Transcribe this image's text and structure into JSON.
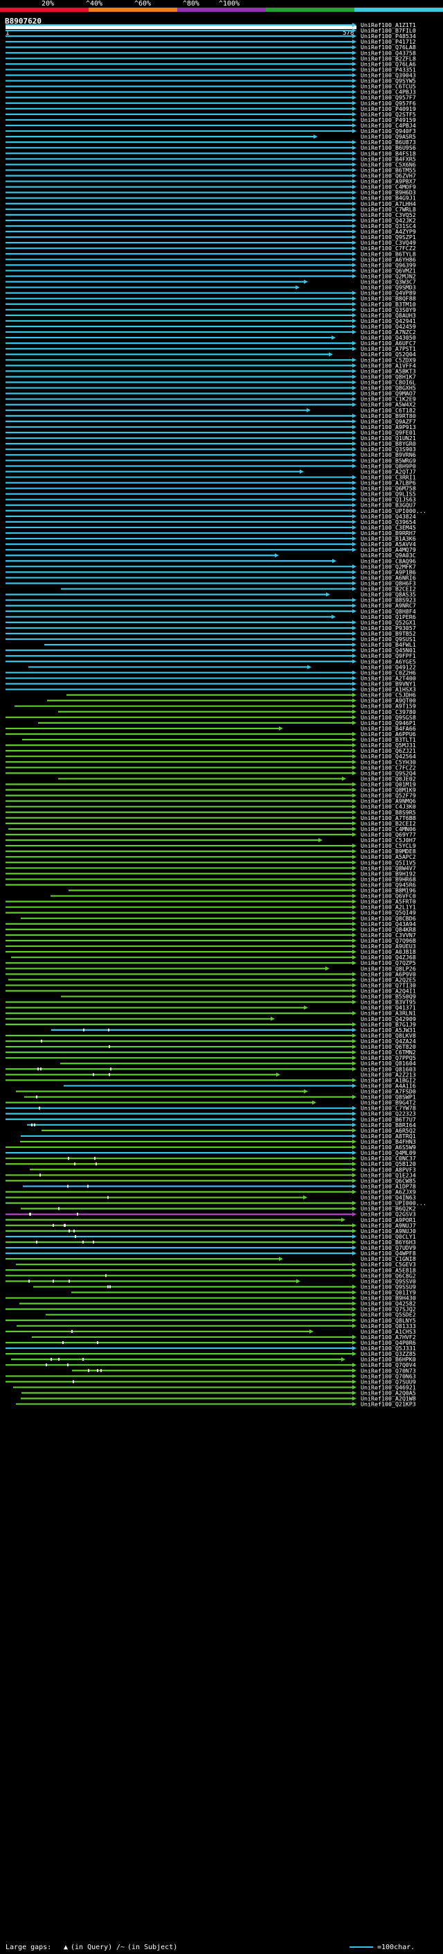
{
  "header": {
    "pct_labels": [
      "20%",
      "^40%",
      "^60%",
      "^80%",
      "^100%"
    ],
    "scale_colors": [
      "#e8112d",
      "#f07f1a",
      "#9c2fb0",
      "#22a32b",
      "#3ec7e8"
    ]
  },
  "query": {
    "id": "B8907620",
    "start": "1",
    "end": "578"
  },
  "colors": {
    "cyan": "#39c4e6",
    "green": "#5fcb2e",
    "magenta": "#b83dc8",
    "tick": "#ffffff"
  },
  "hits": [
    "UniRef100_A1Z1T1",
    "UniRef100_B7FIL0",
    "UniRef100_P48534",
    "UniRef100_P41712",
    "UniRef100_Q76LA8",
    "UniRef100_Q43758",
    "UniRef100_B2ZFL8",
    "UniRef100_Q76LA6",
    "UniRef100_P43351",
    "UniRef100_Q39043",
    "UniRef100_Q9SYW5",
    "UniRef100_C6TCU5",
    "UniRef100_C4PBJ3",
    "UniRef100_Q957F7",
    "UniRef100_Q957F6",
    "UniRef100_P40919",
    "UniRef100_Q2STF5",
    "UniRef100_P49159",
    "UniRef100_C4PBJ4",
    "UniRef100_Q940F3",
    "UniRef100_Q9ASR5",
    "UniRef100_B6U873",
    "UniRef100_B6U9S6",
    "UniRef100_B4FS18",
    "UniRef100_B4FXR5",
    "UniRef100_C5X6N6",
    "UniRef100_B6TM55",
    "UniRef100_Q6ZVH7",
    "UniRef100_A9PBX7",
    "UniRef100_C4MOF9",
    "UniRef100_B9H6D3",
    "UniRef100_B4G9J1",
    "UniRef100_A7LHH4",
    "UniRef100_C7WRL8",
    "UniRef100_C3VQ52",
    "UniRef100_Q42JK2",
    "UniRef100_Q31SC4",
    "UniRef100_A4ZYP9",
    "UniRef100_Q9SZP1",
    "UniRef100_C3VQ49",
    "UniRef100_C7FCZ2",
    "UniRef100_B6TYL8",
    "UniRef100_A6YH86",
    "UniRef100_Q96399",
    "UniRef100_Q6VMZ1",
    "UniRef100_Q2MJN2",
    "UniRef100_Q3W3C7",
    "UniRef100_Q9SMD3",
    "UniRef100_Q4VP89",
    "UniRef100_B8QF88",
    "UniRef100_B3TM10",
    "UniRef100_Q3S0Y9",
    "UniRef100_Q8AUH3",
    "UniRef100_Q42941",
    "UniRef100_Q42459",
    "UniRef100_A7NZC2",
    "UniRef100_Q43050",
    "UniRef100_A6UFC7",
    "UniRef100_A7PST1",
    "UniRef100_Q52Q04",
    "UniRef100_C5ZDX9",
    "UniRef100_A1VFF4",
    "UniRef100_A5BKT3",
    "UniRef100_Q8H1K7",
    "UniRef100_C8OI6L",
    "UniRef100_Q8GXH5",
    "UniRef100_Q9MAO7",
    "UniRef100_C1K2E9",
    "UniRef100_A5W4X2",
    "UniRef100_C6T182",
    "UniRef100_B9RT80",
    "UniRef100_Q9AZF7",
    "UniRef100_A9P913",
    "UniRef100_Q9FE01",
    "UniRef100_Q1UN21",
    "UniRef100_B8YGR0",
    "UniRef100_Q3S903",
    "UniRef100_B9VRN6",
    "UniRef100_B5WRG9",
    "UniRef100_Q8H9P0",
    "UniRef100_A2QTJ7",
    "UniRef100_C3RRI1",
    "UniRef100_A7LBP6",
    "UniRef100_Q6M758",
    "UniRef100_Q9LIS5",
    "UniRef100_Q1JS63",
    "UniRef100_B3GQU7",
    "UniRef100_UPI000...",
    "UniRef100_Q43824",
    "UniRef100_Q39654",
    "UniRef100_C3EM45",
    "UniRef100_B9RRH7",
    "UniRef100_B1A3K6",
    "UniRef100_A5AVV4",
    "UniRef100_A4MQ79",
    "UniRef100_Q9A03C",
    "UniRef100_C8AQ96",
    "UniRef100_Q2MFK7",
    "UniRef100_A9P1B6",
    "UniRef100_A6NRI6",
    "UniRef100_Q8H6F3",
    "UniRef100_B2CEI2",
    "UniRef100_Q8AS35",
    "UniRef100_B8S923",
    "UniRef100_A9NRC7",
    "UniRef100_Q8H8F4",
    "UniRef100_Q1PER6",
    "UniRef100_Q52GX1",
    "UniRef100_P93057",
    "UniRef100_B9TB52",
    "UniRef100_Q9SUS1",
    "UniRef100_B4FWL1",
    "UniRef100_Q45N01",
    "UniRef100_Q9FPF1",
    "UniRef100_A6YGE5",
    "UniRef100_Q49122",
    "UniRef100_C0Z2H6",
    "UniRef100_A2T400",
    "UniRef100_B9VNY1",
    "UniRef100_A1HSX3",
    "UniRef100_C5JDH6",
    "UniRef100_A9QT00",
    "UniRef100_A9T159",
    "UniRef100_C39780",
    "UniRef100_Q9SGS8",
    "UniRef100_Q946P1",
    "UniRef100_B4FA66",
    "UniRef100_A6PPU6",
    "UniRef100_B3TLT1",
    "UniRef100_Q5MJ31",
    "UniRef100_Q6ZJ21",
    "UniRef100_Q42564",
    "UniRef100_C5YH30",
    "UniRef100_C7FCZ2",
    "UniRef100_Q9S2Q4",
    "UniRef100_Q0JE02",
    "UniRef100_Q01M19",
    "UniRef100_Q8M1K9",
    "UniRef100_Q52F79",
    "UniRef100_A9NMQ6",
    "UniRef100_C4J3K0",
    "UniRef100_B8S9R5",
    "UniRef100_A7T6B8",
    "UniRef100_B2CEI2",
    "UniRef100_C4MN06",
    "UniRef100_Q69Y77",
    "UniRef100_C5J0H7",
    "UniRef100_C5YCL9",
    "UniRef100_B9MDE8",
    "UniRef100_A5APC2",
    "UniRef100_Q5I1V5",
    "UniRef100_Q8W4V7",
    "UniRef100_B9H192",
    "UniRef100_B9HR68",
    "UniRef100_Q945R6",
    "UniRef100_B8M196",
    "UniRef100_Q6VFC0",
    "UniRef100_A5FRT0",
    "UniRef100_A2L1Y1",
    "UniRef100_Q5QI49",
    "UniRef100_Q8CBD6",
    "UniRef100_Q43A94",
    "UniRef100_Q84KR8",
    "UniRef100_C3VVN7",
    "UniRef100_Q7Q96B",
    "UniRef100_A9UEU3",
    "UniRef100_A0JB18",
    "UniRef100_Q4ZJ68",
    "UniRef100_Q7QZP5",
    "UniRef100_Q8LP26",
    "UniRef100_A6P9V0",
    "UniRef100_A2Q2E5",
    "UniRef100_Q7TI30",
    "UniRef100_A2Q4I1",
    "UniRef100_B5S0Q9",
    "UniRef100_B3VT95",
    "UniRef100_Q41371",
    "UniRef100_A3RLN1",
    "UniRef100_Q42909",
    "UniRef100_B7G1J9",
    "UniRef100_A5JW31",
    "UniRef100_Q8LKV8",
    "UniRef100_Q4ZA24",
    "UniRef100_Q6T820",
    "UniRef100_C6TMN2",
    "UniRef100_Q7PPQ5",
    "UniRef100_Q81604",
    "UniRef100_Q81603",
    "UniRef100_A2Z213",
    "UniRef100_A1BGI2",
    "UniRef100_A4A1I6",
    "UniRef100_A7FSD0",
    "UniRef100_Q8SWP1",
    "UniRef100_B9G4T2",
    "UniRef100_C7YW78",
    "UniRef100_Q22323",
    "UniRef100_B6T7U7",
    "UniRef100_B8RI64",
    "UniRef100_A6R5Q2",
    "UniRef100_A8TRQ1",
    "UniRef100_B4FHN3",
    "UniRef100_A6S5W9",
    "UniRef100_Q4ML09",
    "UniRef100_C0NC37",
    "UniRef100_Q5B120",
    "UniRef100_A8PVF3",
    "UniRef100_Q1E2J4",
    "UniRef100_Q6CW85",
    "UniRef100_A1DP78",
    "UniRef100_A6ZJX9",
    "UniRef100_Q4IN63",
    "UniRef100_UPI000...",
    "UniRef100_B6Q2K2",
    "UniRef100_Q2GSV3",
    "UniRef100_A9POR1",
    "UniRef100_A9NUJ7",
    "UniRef100_A9NUJ0",
    "UniRef100_Q0CLY1",
    "UniRef100_B6Y6H3",
    "UniRef100_Q7UDV9",
    "UniRef100_Q4WPF8",
    "UniRef100_C1GNI8",
    "UniRef100_C5GEV3",
    "UniRef100_A5E818",
    "UniRef100_Q6C8G2",
    "UniRef100_Q9SSV0",
    "UniRef100_Q9SSU9",
    "UniRef100_Q01IY9",
    "UniRef100_B9H430",
    "UniRef100_Q42582",
    "UniRef100_Q7SJQ2",
    "UniRef100_Q5SDE2",
    "UniRef100_Q8LNY5",
    "UniRef100_Q81333",
    "UniRef100_A1CHS3",
    "UniRef100_A7HVF2",
    "UniRef100_Q4P0R6",
    "UniRef100_Q5J331",
    "UniRef100_Q3ZZ85",
    "UniRef100_B6HPK0",
    "UniRef100_Q7Q0V4",
    "UniRef100_Q70N73",
    "UniRef100_Q70N63",
    "UniRef100_Q7SUU9",
    "UniRef100_Q46921",
    "UniRef100_A2Q0A5",
    "UniRef100_A2Q1W8",
    "UniRef100_Q21KP3"
  ],
  "footer": {
    "large_gaps_label": "Large gaps:",
    "in_query": "(in Query)",
    "in_subject": "(in Subject)",
    "scale": "=100char."
  }
}
